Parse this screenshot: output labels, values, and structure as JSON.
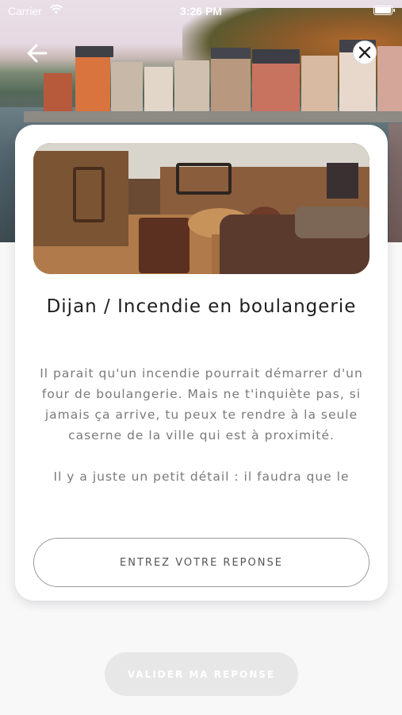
{
  "status_bar": {
    "carrier": "Carrier",
    "time": "3:26 PM"
  },
  "header": {
    "back_icon": "arrow-left-icon",
    "close_icon": "close-icon"
  },
  "card": {
    "title": "Dijan / Incendie en boulangerie",
    "paragraphs": [
      "Il parait qu'un incendie pourrait démarrer d'un four de boulangerie. Mais ne t'inquiète pas, si jamais ça arrive, tu peux te rendre à la seule caserne de la ville qui est à proximité.",
      "Il y a juste un petit détail : il faudra que le"
    ],
    "answer_button_label": "ENTREZ VOTRE REPONSE"
  },
  "validate_button_label": "VALIDER MA REPONSE",
  "colors": {
    "background": "#f8f8f9",
    "card": "#ffffff",
    "validate_disabled": "#e7e7e8",
    "body_text": "#7a7a7a"
  }
}
